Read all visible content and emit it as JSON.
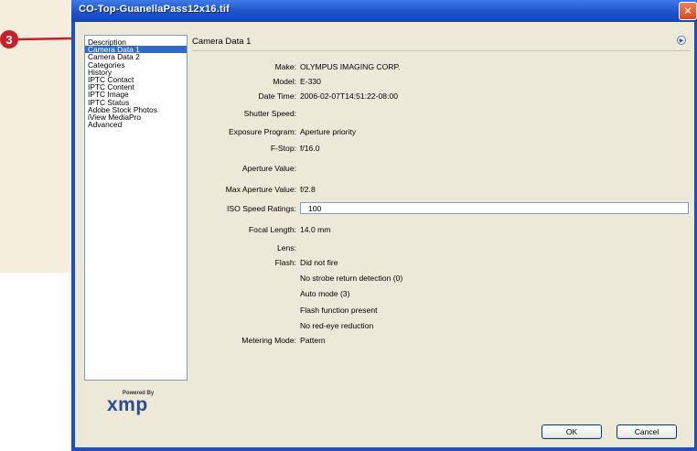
{
  "callout": {
    "number": "3"
  },
  "window": {
    "title": "CO-Top-GuanellaPass12x16.tif",
    "close_glyph": "✕"
  },
  "categories": [
    "Description",
    "Camera Data 1",
    "Camera Data 2",
    "Categories",
    "History",
    "IPTC Contact",
    "IPTC Content",
    "IPTC Image",
    "IPTC Status",
    "Adobe Stock Photos",
    "iView MediaPro",
    "Advanced"
  ],
  "selected_category": "Camera Data 1",
  "panel": {
    "title": "Camera Data 1",
    "info_icon": "info-arrow-icon"
  },
  "fields": [
    {
      "label": "Make:",
      "value": "OLYMPUS IMAGING CORP."
    },
    {
      "label": "Model:",
      "value": "E-330"
    },
    {
      "label": "Date Time:",
      "value": "2006-02-07T14:51:22-08:00"
    },
    {
      "label": "Shutter Speed:",
      "value": ""
    },
    {
      "label": "Exposure Program:",
      "value": "Aperture priority"
    },
    {
      "label": "F-Stop:",
      "value": "f/16.0"
    },
    {
      "label": "Aperture Value:",
      "value": ""
    },
    {
      "label": "Max Aperture Value:",
      "value": "f/2.8"
    },
    {
      "label": "ISO Speed Ratings:",
      "value": "100"
    },
    {
      "label": "Focal Length:",
      "value": "14.0 mm"
    },
    {
      "label": "Lens:",
      "value": ""
    },
    {
      "label": "Flash:",
      "value": "Did not fire"
    },
    {
      "label": "",
      "value": "No strobe return detection (0)"
    },
    {
      "label": "",
      "value": "Auto mode (3)"
    },
    {
      "label": "",
      "value": "Flash function present"
    },
    {
      "label": "",
      "value": "No red-eye reduction"
    },
    {
      "label": "Metering Mode:",
      "value": "Pattern"
    }
  ],
  "logo": {
    "small": "Powered By",
    "big": "xmp"
  },
  "buttons": {
    "ok": "OK",
    "cancel": "Cancel"
  },
  "colors": {
    "title_bar": "#1c4fc8",
    "selection": "#316ac5",
    "callout": "#c8202a",
    "dialog_bg": "#ece9d8"
  }
}
